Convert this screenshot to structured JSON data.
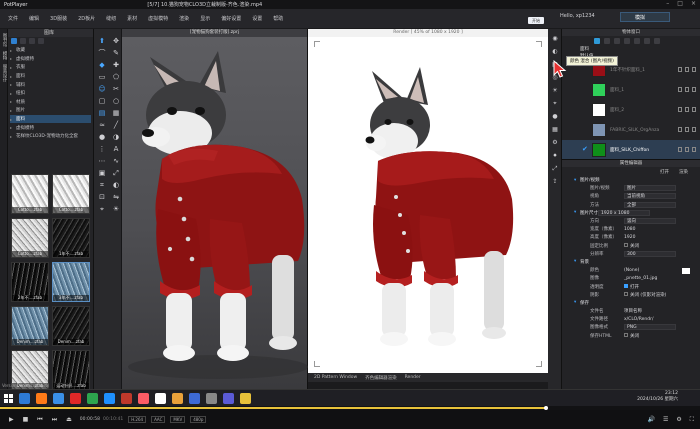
{
  "player": {
    "name": "PotPlayer",
    "title": "[5/7] 10.猫狗宠物CLO3D立裁制版-齐色.渲染.mp4"
  },
  "menu": [
    "文件",
    "编辑",
    "3D服装",
    "2D板片",
    "缝纫",
    "素材",
    "虚拟模特",
    "渲染",
    "显示",
    "偏好设置",
    "设置",
    "帮助"
  ],
  "header": {
    "flag_label": "开始",
    "user": "Hello, xp1234",
    "mode": "模拟"
  },
  "left_strip": [
    "图书馆",
    "模特",
    "服装设计"
  ],
  "library": {
    "title": "图库",
    "tree": [
      {
        "label": "收藏",
        "sel": false
      },
      {
        "label": "虚拟模特",
        "sel": false
      },
      {
        "label": "衣服",
        "sel": false
      },
      {
        "label": "面料",
        "sel": false
      },
      {
        "label": "辅料",
        "sel": false
      },
      {
        "label": "纽扣",
        "sel": false
      },
      {
        "label": "材质",
        "sel": false
      },
      {
        "label": "图片",
        "sel": false
      },
      {
        "label": "面料",
        "sel": true
      },
      {
        "label": "虚拟模特",
        "sel": false
      },
      {
        "label": "花样纹CLO3D-宠物动力化全套",
        "sel": false
      }
    ],
    "thumbs": [
      {
        "label": "Cotto....zfab",
        "tex": "fab1",
        "sel": false
      },
      {
        "label": "Cotto....zfab",
        "tex": "fab1",
        "sel": false
      },
      {
        "label": "Cotto....zfab",
        "tex": "fab4",
        "sel": false
      },
      {
        "label": "1年不....zfab",
        "tex": "fab2",
        "sel": false
      },
      {
        "label": "2年不....zfab",
        "tex": "fab5",
        "sel": false
      },
      {
        "label": "3年不....zfab",
        "tex": "fab3",
        "sel": true
      },
      {
        "label": "Denim....zfab",
        "tex": "fab3",
        "sel": false
      },
      {
        "label": "Denim....zfab",
        "tex": "fab2",
        "sel": false
      },
      {
        "label": "Denim....zfab",
        "tex": "fab4",
        "sel": false
      },
      {
        "label": "运动针织....zfab",
        "tex": "fab5",
        "sel": false
      }
    ],
    "version": "Version: 7.2.88 (44936)"
  },
  "viewport3d": {
    "title": "[宠物猫狗套装打版].zprj"
  },
  "render": {
    "title": "Render  [ 45% of 1080 x 1920 ]"
  },
  "bottom_tabs": [
    "2D Pattern Window",
    "齐色编辑器渲染",
    "Render"
  ],
  "object_browser": {
    "title": "物体窗口",
    "section": "面料",
    "section2": "默认值",
    "swatches": [
      {
        "name": "1年不针织面料_1",
        "color": "#9a0e16",
        "sel": false,
        "chk": false
      },
      {
        "name": "面料_1",
        "color": "#2fd05a",
        "sel": false,
        "chk": false
      },
      {
        "name": "面料_2",
        "color": "#ffffff",
        "sel": false,
        "chk": false
      },
      {
        "name": "FABRIC_SILK_OrgAnza",
        "color": "#7f95b4",
        "sel": false,
        "chk": false
      },
      {
        "name": "面料_SILK_Chiffon",
        "color": "#0f8f1a",
        "sel": true,
        "chk": true
      }
    ],
    "tooltip": "颜色 混合 (图片/视频)"
  },
  "property_editor": {
    "title": "属性编辑器",
    "tabs": [
      "打开",
      "渲染"
    ],
    "rows": [
      {
        "k": "图片/视频",
        "v": "",
        "sec": true
      },
      {
        "k": "图片/视频",
        "v": "图片",
        "dd": true
      },
      {
        "k": "视角",
        "v": "当前视角",
        "dd": true
      },
      {
        "k": "方法",
        "v": "全部",
        "dd": true
      },
      {
        "k": "图片尺寸",
        "v": "1920 x 1080",
        "sec": true,
        "dd": true
      },
      {
        "k": "方向",
        "v": "竖向",
        "dd": true
      },
      {
        "k": "宽度（像素）",
        "v": "1080"
      },
      {
        "k": "高度（像素）",
        "v": "1920"
      },
      {
        "k": "固定比例",
        "v": "关闭",
        "ck": true,
        "on": false
      },
      {
        "k": "分辨率",
        "v": "300",
        "dd": true
      },
      {
        "k": "背景",
        "v": "",
        "sec": true
      },
      {
        "k": "颜色",
        "v": "(None)",
        "white": true
      },
      {
        "k": "图像",
        "v": "_pnette_01.jpg"
      },
      {
        "k": "透明度",
        "v": "打开",
        "ck": true,
        "on": true
      },
      {
        "k": "阴影",
        "v": "关闭 (仅影对渲染)",
        "ck": true,
        "on": false
      },
      {
        "k": "保存",
        "v": "",
        "sec": true
      },
      {
        "k": "文件名",
        "v": "项目名称"
      },
      {
        "k": "文件路径",
        "v": "x/CLO/Rendr/"
      },
      {
        "k": "图像格式",
        "v": "PNG",
        "dd": true
      },
      {
        "k": "保存HTML",
        "v": "关闭",
        "ck": true,
        "on": false
      }
    ]
  },
  "taskbar": {
    "icons": [
      "#2d7ad6",
      "#ff7a18",
      "#3a8fe8",
      "#e02828",
      "#2da44e",
      "#1e90ff",
      "#c0392b",
      "#fc5c65",
      "#ffffff",
      "#e9a13a",
      "#3d6ad6",
      "#888888",
      "#5b5bd6",
      "#e8c23a"
    ],
    "time": "23:12",
    "date": "2024/10/26 星期六"
  },
  "playback": {
    "elapsed": "00:00:58",
    "total": "00:10:41",
    "chips": [
      "H.264",
      "AAC",
      "MKV",
      "480p"
    ],
    "progress": 0.78
  }
}
